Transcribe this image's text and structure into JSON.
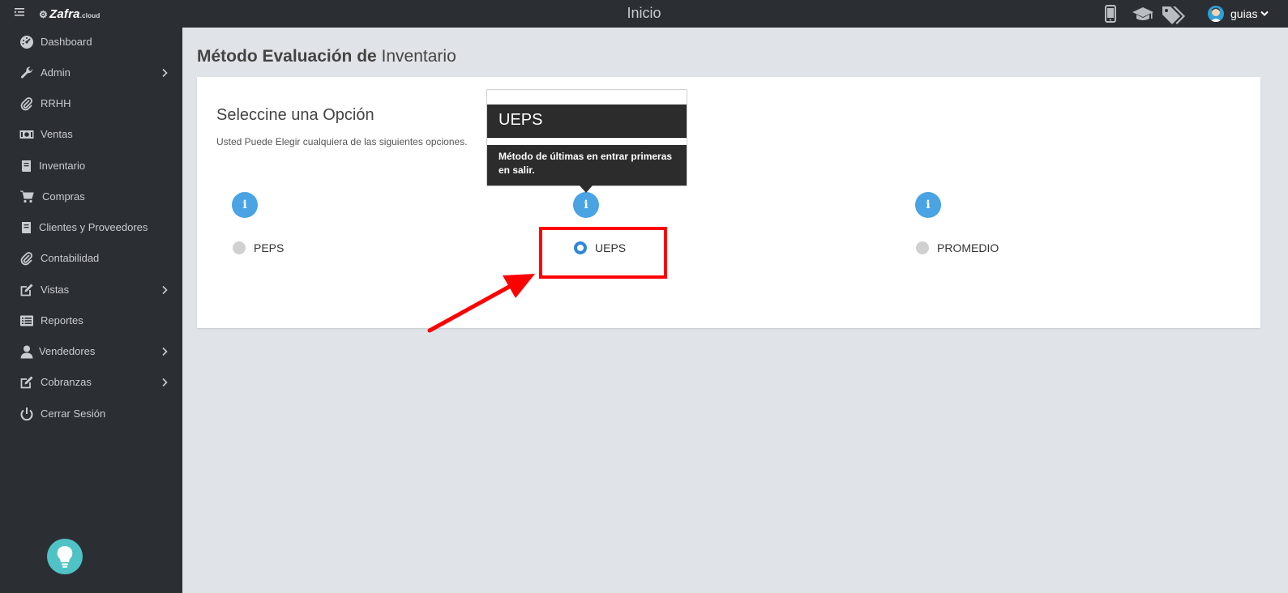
{
  "header": {
    "title": "Inicio",
    "logo_text": "Zafra",
    "logo_suffix": ".cloud",
    "user": {
      "name": "guias"
    }
  },
  "sidebar": {
    "items": [
      {
        "label": "Dashboard",
        "icon": "dashboard-icon",
        "has_submenu": false
      },
      {
        "label": "Admin",
        "icon": "wrench-icon",
        "has_submenu": true
      },
      {
        "label": "RRHH",
        "icon": "paperclip-icon",
        "has_submenu": false
      },
      {
        "label": "Ventas",
        "icon": "money-icon",
        "has_submenu": false
      },
      {
        "label": "Inventario",
        "icon": "book-icon",
        "has_submenu": false
      },
      {
        "label": "Compras",
        "icon": "cart-icon",
        "has_submenu": false
      },
      {
        "label": "Clientes y Proveedores",
        "icon": "book-icon",
        "has_submenu": false
      },
      {
        "label": "Contabilidad",
        "icon": "paperclip-icon",
        "has_submenu": false
      },
      {
        "label": "Vistas",
        "icon": "edit-icon",
        "has_submenu": true
      },
      {
        "label": "Reportes",
        "icon": "list-icon",
        "has_submenu": false
      },
      {
        "label": "Vendedores",
        "icon": "user-icon",
        "has_submenu": true
      },
      {
        "label": "Cobranzas",
        "icon": "edit-icon",
        "has_submenu": true
      },
      {
        "label": "Cerrar Sesión",
        "icon": "power-icon",
        "has_submenu": false
      }
    ]
  },
  "main": {
    "page_title_bold": "Método Evaluación de",
    "page_title_light": "Inventario",
    "section_title": "Seleccine una Opción",
    "section_subtitle": "Usted Puede Elegir cualquiera de las siguientes opciones.",
    "options": [
      {
        "label": "PEPS",
        "checked": false
      },
      {
        "label": "UEPS",
        "checked": true
      },
      {
        "label": "PROMEDIO",
        "checked": false
      }
    ],
    "popover": {
      "title": "UEPS",
      "body": "Método de últimas en entrar primeras en salir."
    }
  },
  "colors": {
    "sidebar_bg": "#2b2e33",
    "content_bg": "#e0e4e9",
    "info_blue": "#4aa3e2",
    "radio_checked": "#2f87d8",
    "annotation_red": "#ff0000",
    "bulb_teal": "#4fc2c5"
  }
}
